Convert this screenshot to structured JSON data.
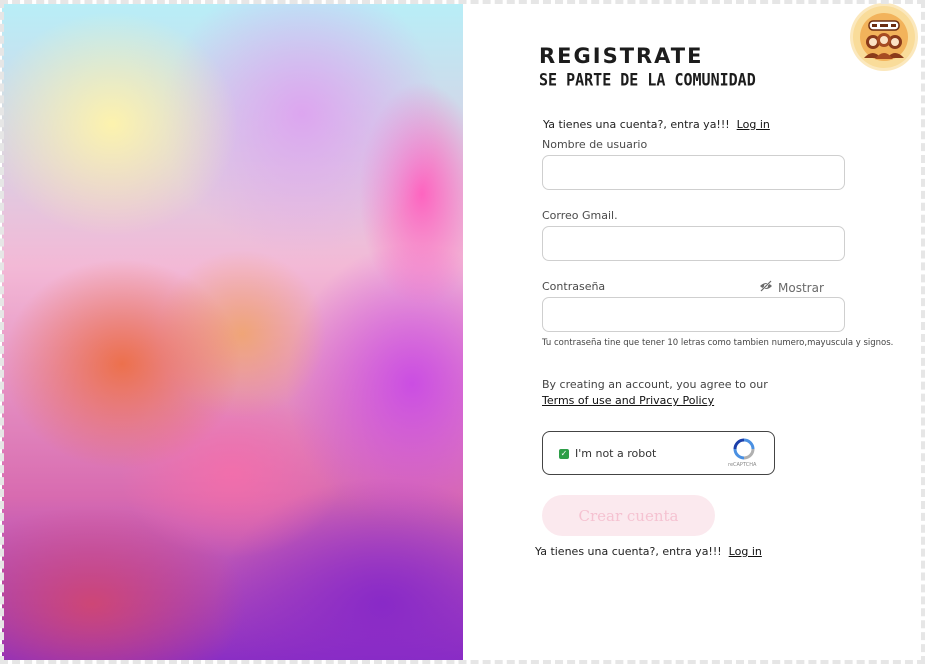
{
  "header": {
    "title": "REGISTRATE",
    "subtitle": "SE PARTE DE LA COMUNIDAD"
  },
  "login_prompt": {
    "text": "Ya tienes una cuenta?, entra ya!!!",
    "link": "Log in"
  },
  "form": {
    "username": {
      "label": "Nombre de usuario",
      "value": ""
    },
    "email": {
      "label": "Correo Gmail.",
      "value": ""
    },
    "password": {
      "label": "Contraseña",
      "value": "",
      "toggle_label": "Mostrar",
      "toggle_icon": "eye-slash-icon",
      "hint": "Tu contraseña tine que tener 10 letras como tambien numero,mayuscula y signos."
    }
  },
  "terms": {
    "text": "By creating an account, you agree to our",
    "link": "Terms of use and Privacy Policy"
  },
  "captcha": {
    "label": "I'm not a robot",
    "brand": "reCAPTCHA",
    "checked": true,
    "check_color": "#2e9e48"
  },
  "submit": {
    "label": "Crear cuenta",
    "background": "#fbe9ee",
    "text_color": "#f5c2d1"
  },
  "logo": {
    "icon": "community-logo-icon"
  }
}
